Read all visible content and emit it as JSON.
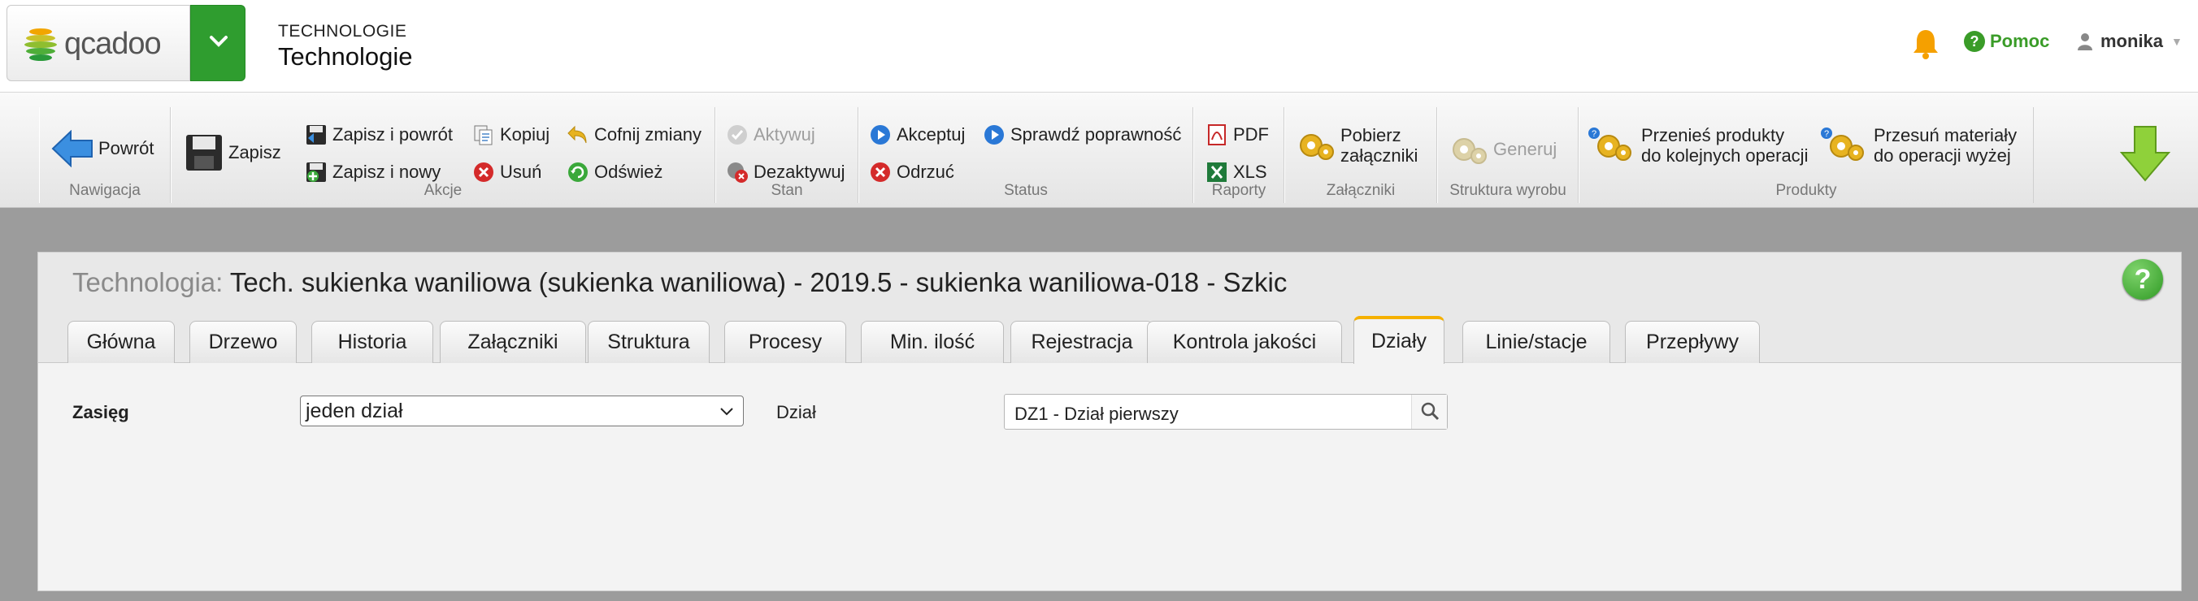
{
  "header": {
    "logo_text": "qcadoo",
    "category": "TECHNOLOGIE",
    "title": "Technologie",
    "help_label": "Pomoc",
    "user_name": "monika",
    "accent_color": "#2f9d2f"
  },
  "ribbon": {
    "groups": {
      "navigation": "Nawigacja",
      "actions": "Akcje",
      "state": "Stan",
      "status": "Status",
      "reports": "Raporty",
      "attachments": "Załączniki",
      "structure": "Struktura wyrobu",
      "products": "Produkty"
    },
    "buttons": {
      "back": "Powrót",
      "save": "Zapisz",
      "save_and_back": "Zapisz i powrót",
      "save_and_new": "Zapisz i nowy",
      "copy": "Kopiuj",
      "delete": "Usuń",
      "revert": "Cofnij zmiany",
      "refresh": "Odśwież",
      "activate": "Aktywuj",
      "deactivate": "Dezaktywuj",
      "accept": "Akceptuj",
      "reject": "Odrzuć",
      "check_validity": "Sprawdź poprawność",
      "pdf": "PDF",
      "xls": "XLS",
      "download_line1": "Pobierz",
      "download_line2": "załączniki",
      "generate": "Generuj",
      "move_products_line1": "Przenieś produkty",
      "move_products_line2": "do kolejnych operacji",
      "move_materials_line1": "Przesuń materiały",
      "move_materials_line2": "do operacji wyżej"
    }
  },
  "panel": {
    "entity_label": "Technologia:",
    "entity_value": "Tech. sukienka waniliowa (sukienka waniliowa) - 2019.5 - sukienka waniliowa-018 - Szkic",
    "tabs": [
      {
        "label": "Główna"
      },
      {
        "label": "Drzewo"
      },
      {
        "label": "Historia"
      },
      {
        "label": "Załączniki"
      },
      {
        "label": "Struktura"
      },
      {
        "label": "Procesy"
      },
      {
        "label": "Min. ilość"
      },
      {
        "label": "Rejestracja"
      },
      {
        "label": "Kontrola jakości"
      },
      {
        "label": "Działy"
      },
      {
        "label": "Linie/stacje"
      },
      {
        "label": "Przepływy"
      }
    ],
    "active_tab": "Działy",
    "form": {
      "range_label": "Zasięg",
      "range_value": "jeden dział",
      "division_label": "Dział",
      "division_value": "DZ1 - Dział pierwszy"
    }
  }
}
